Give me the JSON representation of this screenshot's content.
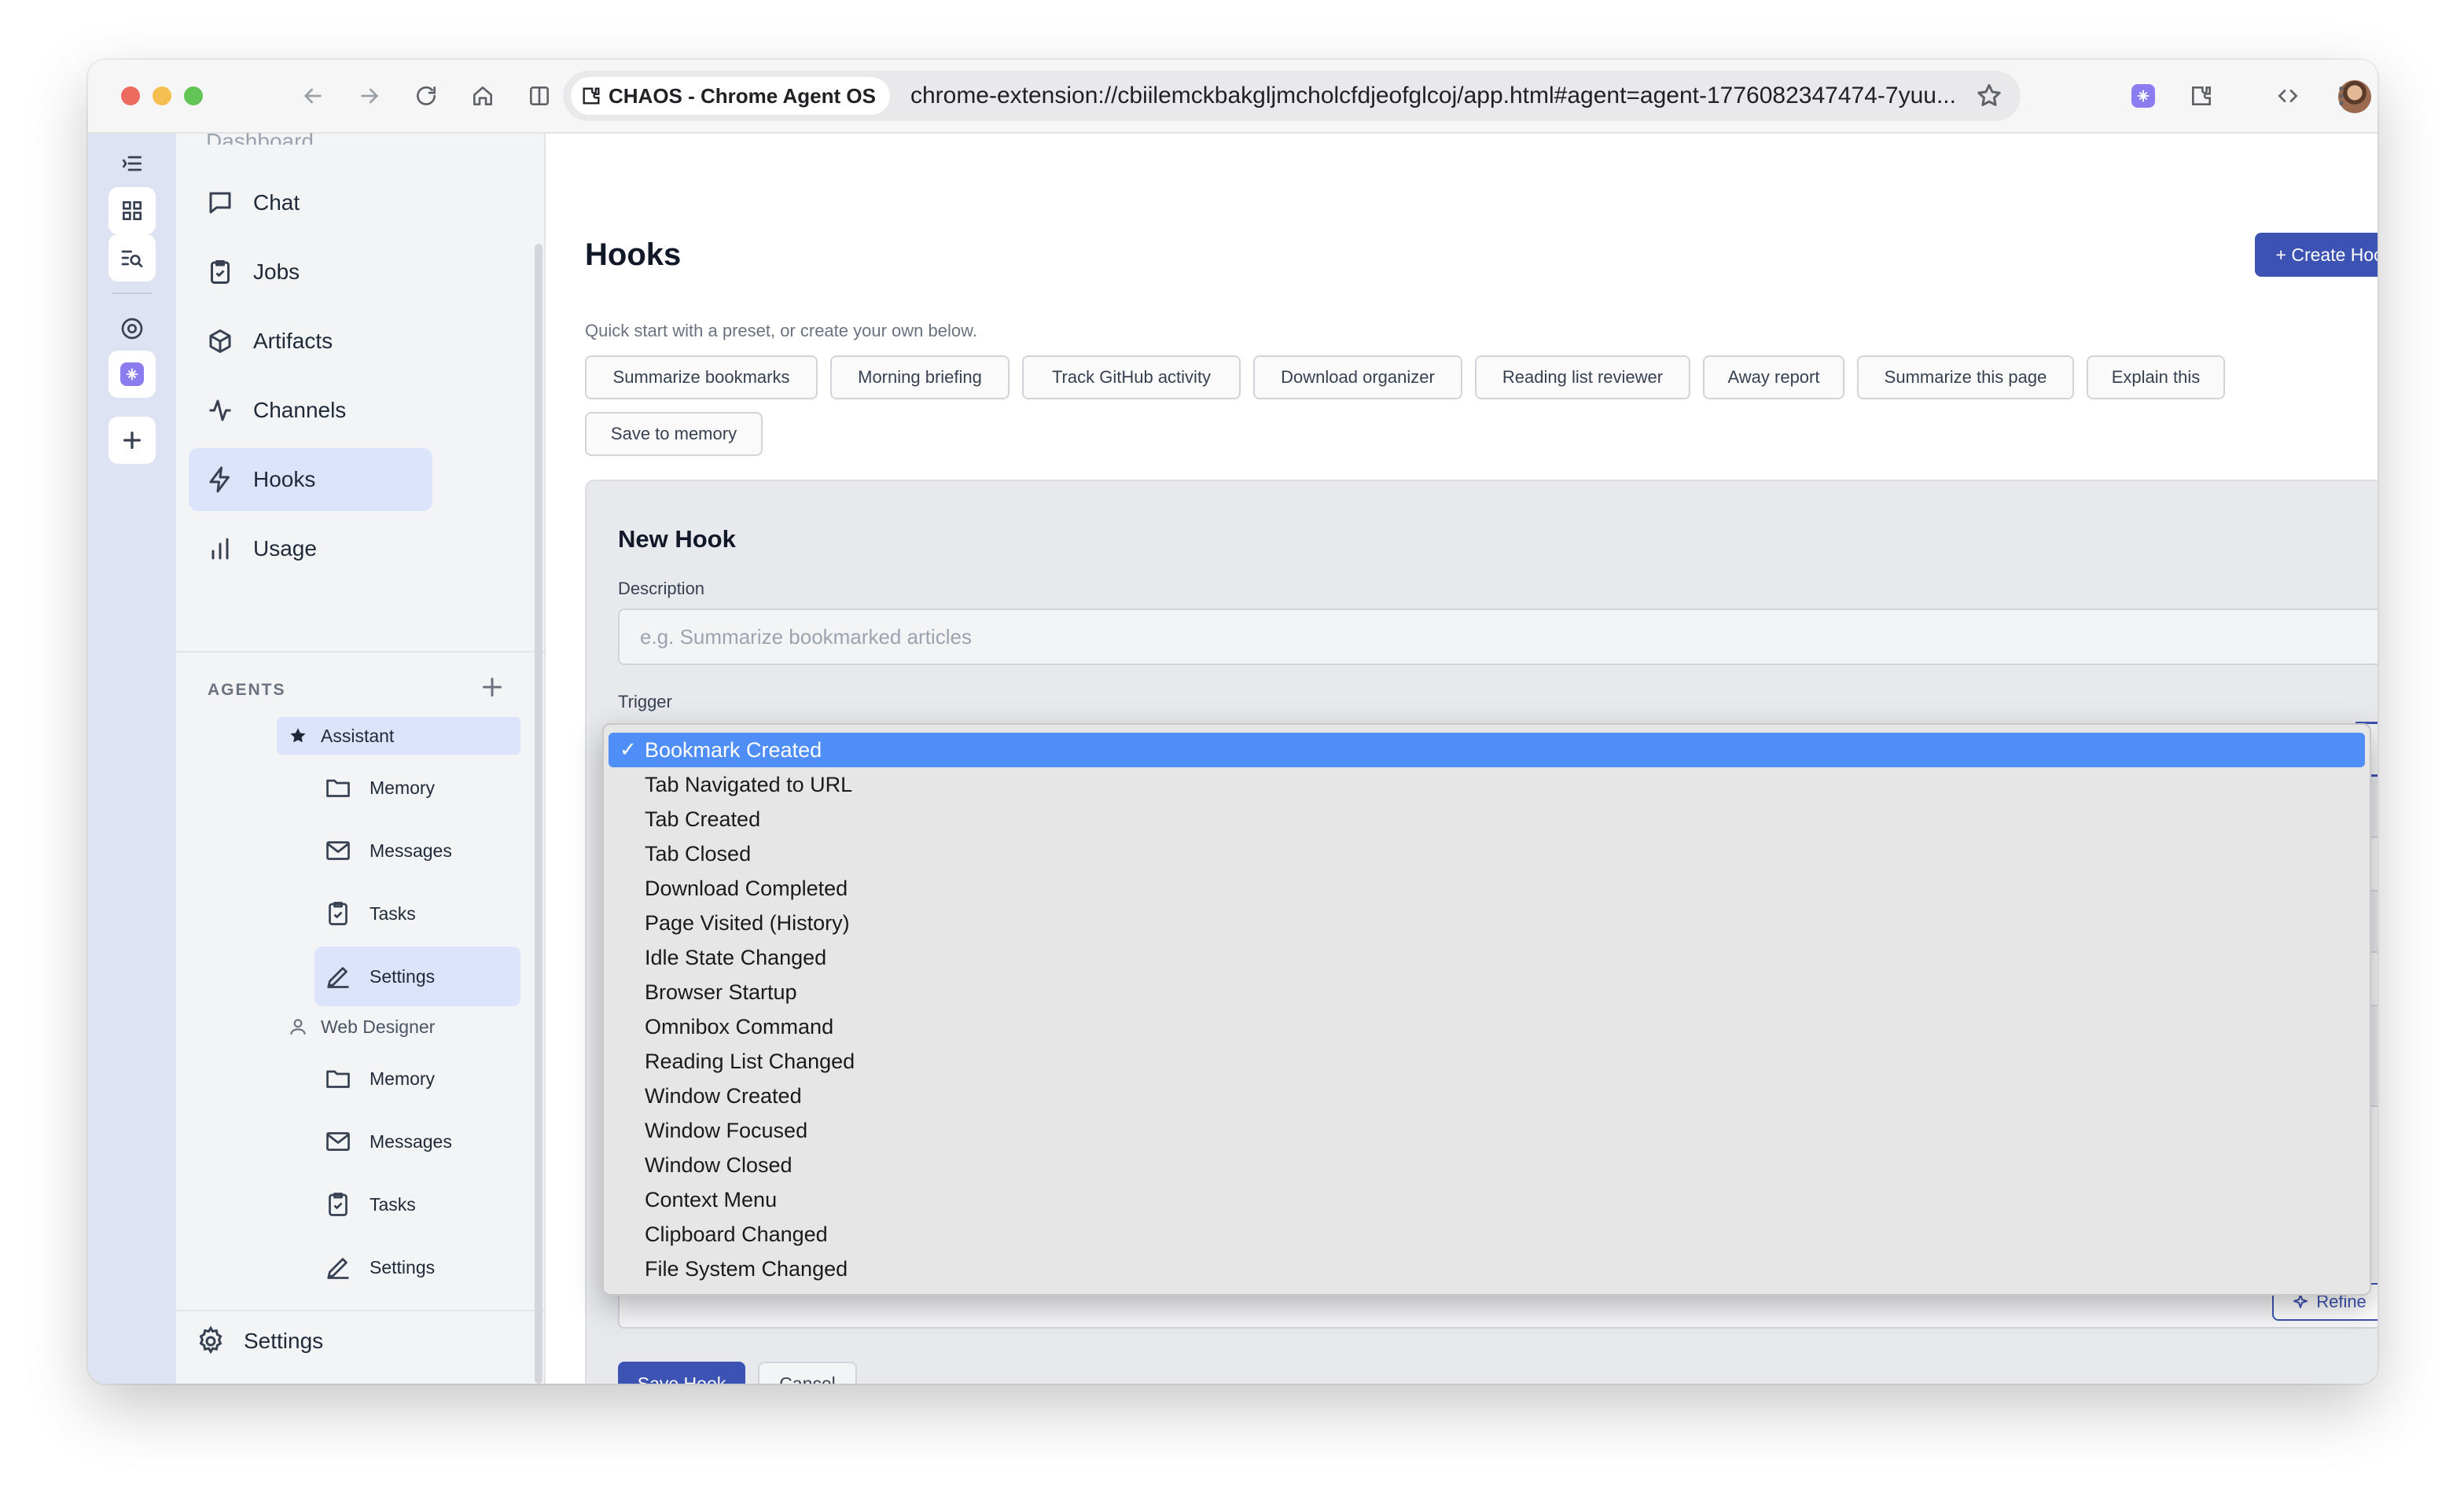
{
  "browser": {
    "tab_chip": "CHAOS - Chrome Agent OS",
    "url": "chrome-extension://cbiilemckbakgljmcholcfdjeofglcoj/app.html#agent=agent-1776082347474-7yuu..."
  },
  "sidebar": {
    "partial_item": "Dashboard",
    "nav": [
      {
        "label": "Chat",
        "icon": "chat-icon"
      },
      {
        "label": "Jobs",
        "icon": "clipboard-icon"
      },
      {
        "label": "Artifacts",
        "icon": "box-icon"
      },
      {
        "label": "Channels",
        "icon": "activity-icon"
      },
      {
        "label": "Hooks",
        "icon": "bolt-icon",
        "active": true
      },
      {
        "label": "Usage",
        "icon": "bar-chart-icon"
      }
    ],
    "agents_heading": "AGENTS",
    "agents": [
      {
        "name": "Assistant",
        "icon": "star-icon",
        "active": true,
        "items": [
          {
            "label": "Memory",
            "icon": "folder-icon"
          },
          {
            "label": "Messages",
            "icon": "mail-icon"
          },
          {
            "label": "Tasks",
            "icon": "clipboard-icon"
          },
          {
            "label": "Settings",
            "icon": "pen-icon",
            "active": true
          }
        ]
      },
      {
        "name": "Web Designer",
        "icon": "user-icon",
        "items": [
          {
            "label": "Memory",
            "icon": "folder-icon"
          },
          {
            "label": "Messages",
            "icon": "mail-icon"
          },
          {
            "label": "Tasks",
            "icon": "clipboard-icon"
          },
          {
            "label": "Settings",
            "icon": "pen-icon"
          }
        ]
      }
    ],
    "settings_label": "Settings"
  },
  "main": {
    "title": "Hooks",
    "create_button": "+ Create Hook",
    "quick_start_hint": "Quick start with a preset, or create your own below.",
    "presets": [
      "Summarize bookmarks",
      "Morning briefing",
      "Track GitHub activity",
      "Download organizer",
      "Reading list reviewer",
      "Away report",
      "Summarize this page",
      "Explain this",
      "Save to memory"
    ],
    "form": {
      "title": "New Hook",
      "description_label": "Description",
      "description_placeholder": "e.g. Summarize bookmarked articles",
      "trigger_label": "Trigger",
      "refine_button": "Refine",
      "save_button": "Save Hook",
      "cancel_button": "Cancel"
    }
  },
  "trigger_dropdown": {
    "selected": "Bookmark Created",
    "options": [
      "Bookmark Created",
      "Tab Navigated to URL",
      "Tab Created",
      "Tab Closed",
      "Download Completed",
      "Page Visited (History)",
      "Idle State Changed",
      "Browser Startup",
      "Omnibox Command",
      "Reading List Changed",
      "Window Created",
      "Window Focused",
      "Window Closed",
      "Context Menu",
      "Clipboard Changed",
      "File System Changed"
    ]
  },
  "colors": {
    "accent": "#3d53b3",
    "active_nav": "#dbe4fb",
    "rail": "#dde3f2",
    "dropdown_highlight": "#4f8ef7"
  }
}
